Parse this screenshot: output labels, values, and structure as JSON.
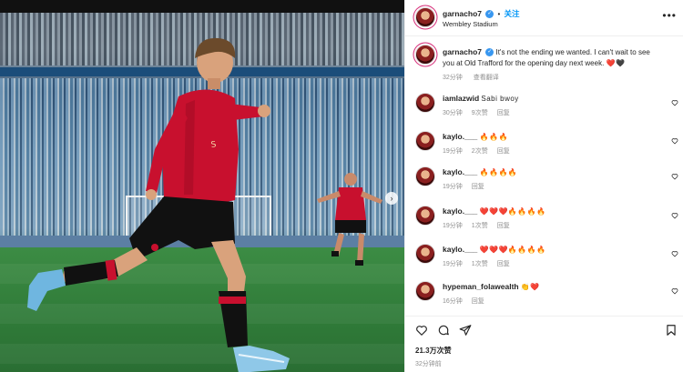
{
  "header": {
    "username": "garnacho7",
    "follow_label": "关注",
    "location": "Wembley Stadium",
    "separator": "•",
    "more_label": "•••"
  },
  "caption": {
    "username": "garnacho7",
    "text": "It's not the ending we wanted. I can't wait to see you at Old Trafford for the opening day next week.",
    "emoji": "❤️🖤",
    "time": "32分钟",
    "translate_label": "查看翻译"
  },
  "comments": [
    {
      "username": "iamlazwid",
      "text": "Sabi bwoy",
      "time": "30分钟",
      "likes": "9次赞",
      "reply": "回复"
    },
    {
      "username": "kaylo.___",
      "text": "🔥🔥🔥",
      "time": "19分钟",
      "likes": "2次赞",
      "reply": "回复"
    },
    {
      "username": "kaylo.___",
      "text": "🔥🔥🔥🔥",
      "time": "19分钟",
      "likes": "",
      "reply": "回复"
    },
    {
      "username": "kaylo.___",
      "text": "❤️❤️❤️🔥🔥🔥🔥",
      "time": "19分钟",
      "likes": "1次赞",
      "reply": "回复"
    },
    {
      "username": "kaylo.___",
      "text": "❤️❤️❤️🔥🔥🔥🔥",
      "time": "19分钟",
      "likes": "1次赞",
      "reply": "回复"
    },
    {
      "username": "hypeman_folawealth",
      "text": "👏❤️",
      "time": "16分钟",
      "likes": "",
      "reply": "回复"
    }
  ],
  "footer": {
    "likes_count": "21.3万次赞",
    "posted_time": "32分钟前"
  },
  "icons": {
    "like": "heart-icon",
    "comment": "comment-icon",
    "share": "send-icon",
    "save": "bookmark-icon",
    "next": "chevron-right-icon"
  },
  "colors": {
    "follow": "#0095f6",
    "verified": "#3897f0",
    "kit_red": "#c8102e"
  }
}
